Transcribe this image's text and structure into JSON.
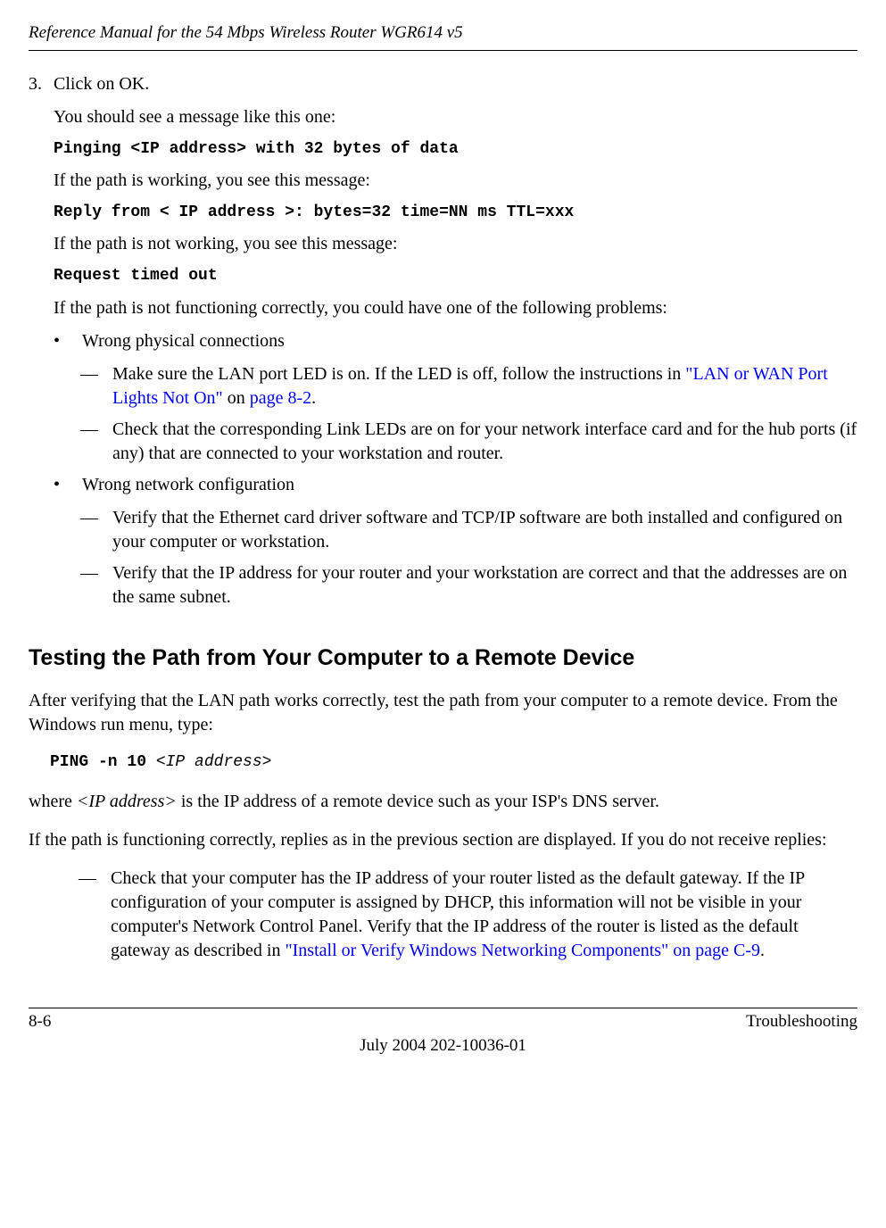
{
  "header": {
    "title": "Reference Manual for the 54 Mbps Wireless Router WGR614 v5"
  },
  "step": {
    "number": "3.",
    "click_ok": "Click on OK.",
    "see_message": "You should see a message like this one:",
    "pinging_line": "Pinging <IP address> with 32 bytes of data",
    "path_working_intro": "If the path is working, you see this message:",
    "reply_line": "Reply from < IP address >: bytes=32 time=NN ms TTL=xxx",
    "path_not_working_intro": "If the path is not working, you see this message:",
    "timeout_line": "Request timed out",
    "not_functioning": "If the path is not functioning correctly, you could have one of the following problems:"
  },
  "bullets": {
    "wrong_phys": "Wrong physical connections",
    "lan_led_pre": "Make sure the LAN port LED is on. If the LED is off, follow the instructions in ",
    "lan_led_link": "\"LAN or WAN Port Lights Not On\"",
    "lan_led_on": " on ",
    "lan_led_page": "page 8-2",
    "lan_led_period": ".",
    "check_link_leds": "Check that the corresponding Link LEDs are on for your network interface card and for the hub ports (if any) that are connected to your workstation and router.",
    "wrong_net": "Wrong network configuration",
    "verify_ethernet": "Verify that the Ethernet card driver software and TCP/IP software are both installed and configured on your computer or workstation.",
    "verify_ip": "Verify that the IP address for your router and your workstation are correct and that the addresses are on the same subnet."
  },
  "heading": "Testing the Path from Your Computer to a Remote Device",
  "after_verify": "After verifying that the LAN path works correctly, test the path from your computer to a remote device. From the Windows run menu, type:",
  "ping_cmd_fixed": "PING -n 10 ",
  "ping_cmd_arg": "<IP address>",
  "where_ip_pre": "where ",
  "where_ip_italic": "<IP address>",
  "where_ip_post": " is the IP address of a remote device such as your ISP's DNS server.",
  "path_correct": "If the path is functioning correctly, replies as in the previous section are displayed. If you do not receive replies:",
  "check_gateway_pre": "Check that your computer has the IP address of your router listed as the default gateway. If the IP configuration of your computer is assigned by DHCP, this information will not be visible in your computer's Network Control Panel. Verify that the IP address of the router is listed as the default gateway as described in ",
  "check_gateway_link": "\"Install or Verify Windows Networking Components\" on page C-9",
  "check_gateway_period": ".",
  "footer": {
    "left": "8-6",
    "right": "Troubleshooting",
    "center": "July 2004 202-10036-01"
  }
}
